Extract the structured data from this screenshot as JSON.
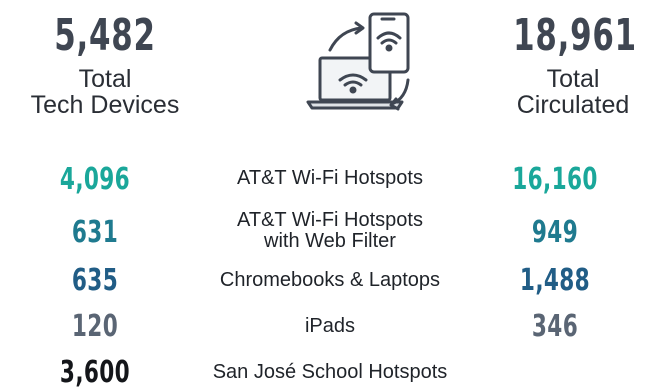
{
  "summary": {
    "total_devices": {
      "value": "5,482",
      "label": "Total\nTech Devices"
    },
    "total_circulated": {
      "value": "18,961",
      "label": "Total\nCirculated"
    }
  },
  "icon": "devices-sync-icon",
  "colors": {
    "teal": "#1aa79a",
    "blue": "#215d86",
    "slate": "#5a6574",
    "black": "#14161a",
    "dark": "#3f4652"
  },
  "rows": [
    {
      "left": "4,096",
      "label": "AT&T Wi-Fi Hotspots",
      "right": "16,160"
    },
    {
      "left": "631",
      "label": "AT&T Wi-Fi Hotspots\nwith Web Filter",
      "right": "949"
    },
    {
      "left": "635",
      "label": "Chromebooks & Laptops",
      "right": "1,488"
    },
    {
      "left": "120",
      "label": "iPads",
      "right": "346"
    },
    {
      "left": "3,600",
      "label": "San José School Hotspots",
      "right": ""
    }
  ]
}
